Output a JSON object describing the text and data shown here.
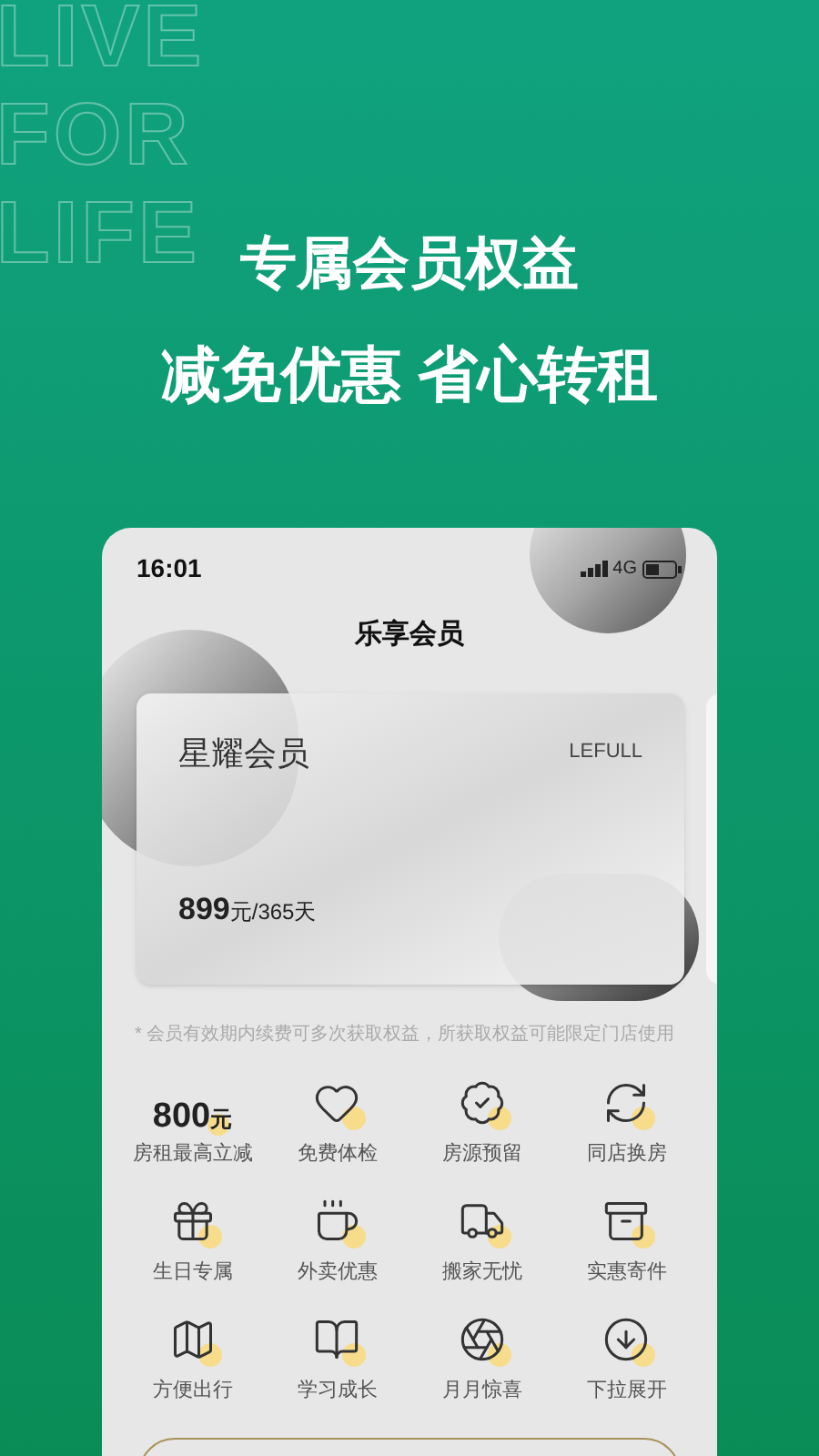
{
  "background_words": [
    "LIVE",
    "FOR",
    "LIFE"
  ],
  "headline": [
    "专属会员权益",
    "减免优惠 省心转租"
  ],
  "phone": {
    "status_bar": {
      "time": "16:01",
      "network": "4G"
    },
    "title": "乐享会员",
    "card": {
      "name": "星耀会员",
      "brand": "LEFULL",
      "price": "899",
      "unit": "元/365天"
    },
    "note": "* 会员有效期内续费可多次获取权益，所获取权益可能限定门店使用",
    "benefits": [
      {
        "kind": "amount",
        "amount": "800",
        "unit": "元",
        "label": "房租最高立减"
      },
      {
        "kind": "icon",
        "label": "免费体检"
      },
      {
        "kind": "icon",
        "label": "房源预留"
      },
      {
        "kind": "icon",
        "label": "同店换房"
      },
      {
        "kind": "icon",
        "label": "生日专属"
      },
      {
        "kind": "icon",
        "label": "外卖优惠"
      },
      {
        "kind": "icon",
        "label": "搬家无忧"
      },
      {
        "kind": "icon",
        "label": "实惠寄件"
      },
      {
        "kind": "icon",
        "label": "方便出行"
      },
      {
        "kind": "icon",
        "label": "学习成长"
      },
      {
        "kind": "icon",
        "label": "月月惊喜"
      },
      {
        "kind": "icon",
        "label": "下拉展开"
      }
    ]
  }
}
